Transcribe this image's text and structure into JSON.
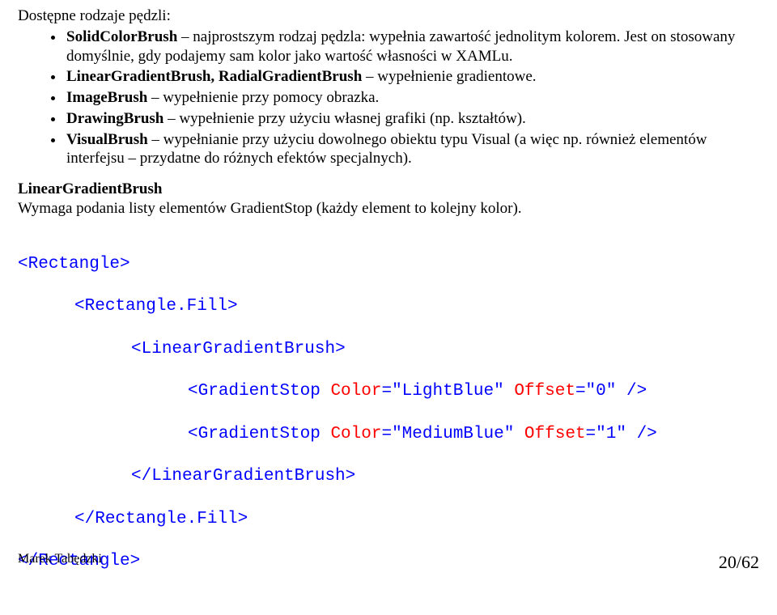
{
  "intro": "Dostępne rodzaje pędzli:",
  "bullets": [
    {
      "bold": "SolidColorBrush",
      "rest": " – najprostszym rodzaj pędzla: wypełnia zawartość jednolitym kolorem. Jest on stosowany domyślnie, gdy podajemy sam kolor jako wartość własności w XAMLu."
    },
    {
      "bold": "LinearGradientBrush, RadialGradientBrush",
      "rest": " – wypełnienie gradientowe."
    },
    {
      "bold": "ImageBrush",
      "rest": " – wypełnienie przy pomocy obrazka."
    },
    {
      "bold": "DrawingBrush",
      "rest": " – wypełnienie przy użyciu własnej grafiki (np. kształtów)."
    },
    {
      "bold": "VisualBrush",
      "rest": " – wypełnianie przy użyciu dowolnego obiektu typu Visual (a więc np. również elementów interfejsu – przydatne do różnych efektów specjalnych)."
    }
  ],
  "section": {
    "heading": "LinearGradientBrush",
    "text": "Wymaga podania listy elementów GradientStop (każdy element to kolejny kolor)."
  },
  "code": {
    "t_rect_open": "Rectangle",
    "t_rectfill_open": "Rectangle.Fill",
    "t_lgb_open": "LinearGradientBrush",
    "t_gstop": "GradientStop",
    "a_color": "Color",
    "a_offset": "Offset",
    "v_lightblue": "\"LightBlue\"",
    "v_mediumblue": "\"MediumBlue\"",
    "v_0": "\"0\"",
    "v_1": "\"1\""
  },
  "footer": {
    "left": "Marek Tabędzki",
    "right": "20/62"
  }
}
